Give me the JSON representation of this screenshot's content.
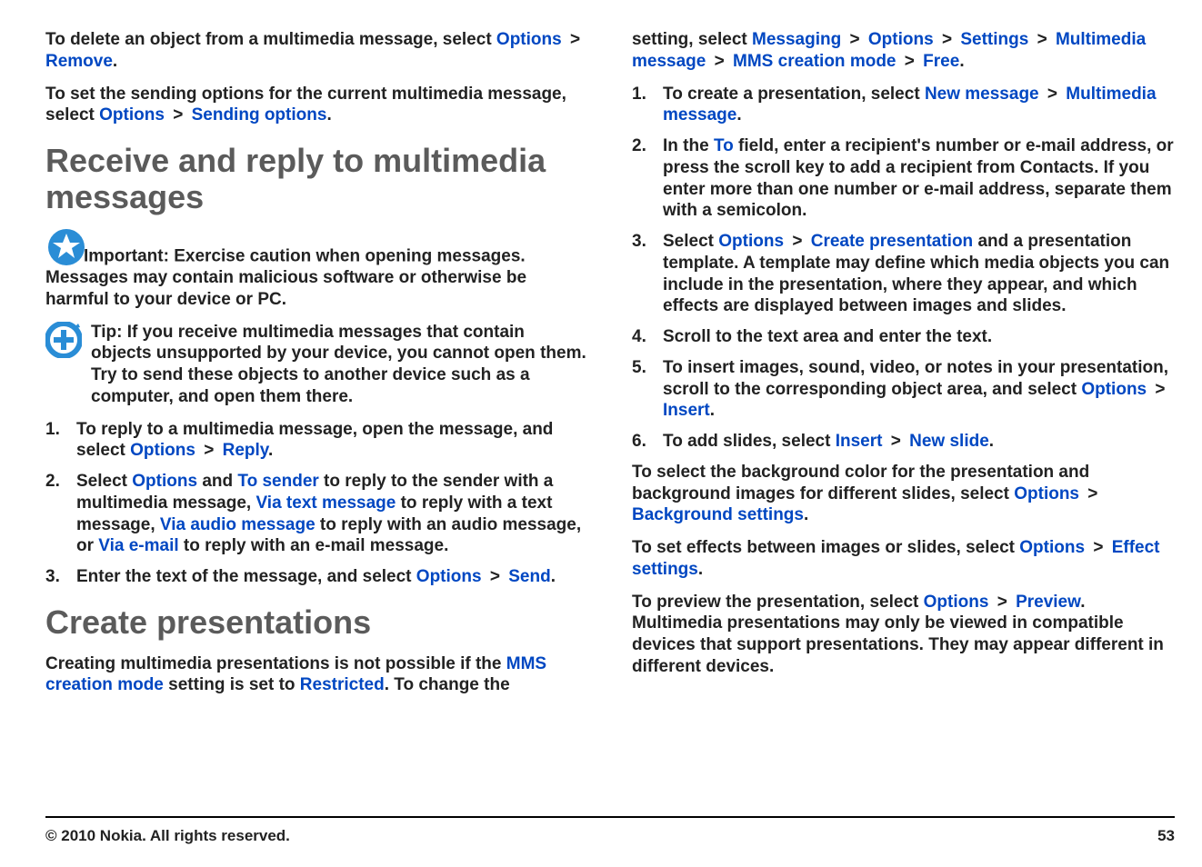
{
  "left": {
    "para1": {
      "pre": "To delete an object from a multimedia message, select ",
      "options": "Options",
      "remove": "Remove",
      "end": "."
    },
    "para2": {
      "pre": "To set the sending options for the current multimedia message, select ",
      "options": "Options",
      "sending": "Sending options",
      "end": "."
    },
    "heading1": "Receive and reply to multimedia messages",
    "important": {
      "label": "Important:",
      "text": "  Exercise caution when opening messages. Messages may contain malicious software or otherwise be harmful to your device or PC."
    },
    "tip": {
      "label": "Tip:",
      "text": " If you receive multimedia messages that contain objects unsupported by your device, you cannot open them. Try to send these objects to another device such as a computer, and open them there."
    },
    "list1": {
      "i1": {
        "pre": "To reply to a multimedia message, open the message, and select ",
        "options": "Options",
        "reply": "Reply",
        "end": "."
      },
      "i2": {
        "pre": "Select ",
        "options": "Options",
        "and": " and ",
        "tosender": "To sender",
        "mid1": " to reply to the sender with a multimedia message, ",
        "viatext": "Via text message",
        "mid2": " to reply with a text message, ",
        "viaaudio": "Via audio message",
        "mid3": " to reply with an audio message, or ",
        "viaemail": "Via e-mail",
        "end": " to reply with an e-mail message."
      },
      "i3": {
        "pre": "Enter the text of the message, and select ",
        "options": "Options",
        "send": "Send",
        "end": "."
      }
    },
    "heading2": "Create presentations",
    "para3": {
      "pre": "Creating multimedia presentations is not possible if the ",
      "mms": "MMS creation mode",
      "mid": " setting is set to ",
      "restricted": "Restricted",
      "end": ". To change the"
    }
  },
  "right": {
    "toppath": {
      "pre": "setting, select ",
      "messaging": "Messaging",
      "options": "Options",
      "settings": "Settings",
      "mmsMsg": "Multimedia message",
      "mmsMode": "MMS creation mode",
      "free": "Free",
      "end": "."
    },
    "list2": {
      "i1": {
        "pre": "To create a presentation, select ",
        "newmsg": "New message",
        "mmsMsg": "Multimedia message",
        "end": "."
      },
      "i2": {
        "pre1": "In the ",
        "to": "To",
        "post": " field, enter a recipient's number or e-mail address, or press the scroll key to add a recipient from Contacts. If you enter more than one number or e-mail address, separate them with a semicolon."
      },
      "i3": {
        "pre": "Select ",
        "options": "Options",
        "create": "Create presentation",
        "post": " and a presentation template. A template may define which media objects you can include in the presentation, where they appear, and which effects are displayed between images and slides."
      },
      "i4": "Scroll to the text area and enter the text.",
      "i5": {
        "pre": "To insert images, sound, video, or notes in your presentation, scroll to the corresponding object area, and select ",
        "options": "Options",
        "insert": "Insert",
        "end": "."
      },
      "i6": {
        "pre": "To add slides, select ",
        "insert": "Insert",
        "newslide": "New slide",
        "end": "."
      }
    },
    "para_bg": {
      "pre": "To select the background color for the presentation and background images for different slides, select ",
      "options": "Options",
      "bg": "Background settings",
      "end": "."
    },
    "para_fx": {
      "pre": "To set effects between images or slides, select ",
      "options": "Options",
      "fx": "Effect settings",
      "end": "."
    },
    "para_preview": {
      "pre": "To preview the presentation, select ",
      "options": "Options",
      "preview": "Preview",
      "post": ". Multimedia presentations may only be viewed in compatible devices that support presentations. They may appear different in different devices."
    }
  },
  "footer": {
    "copyright": "© 2010 Nokia. All rights reserved.",
    "page": "53"
  },
  "gt": ">"
}
